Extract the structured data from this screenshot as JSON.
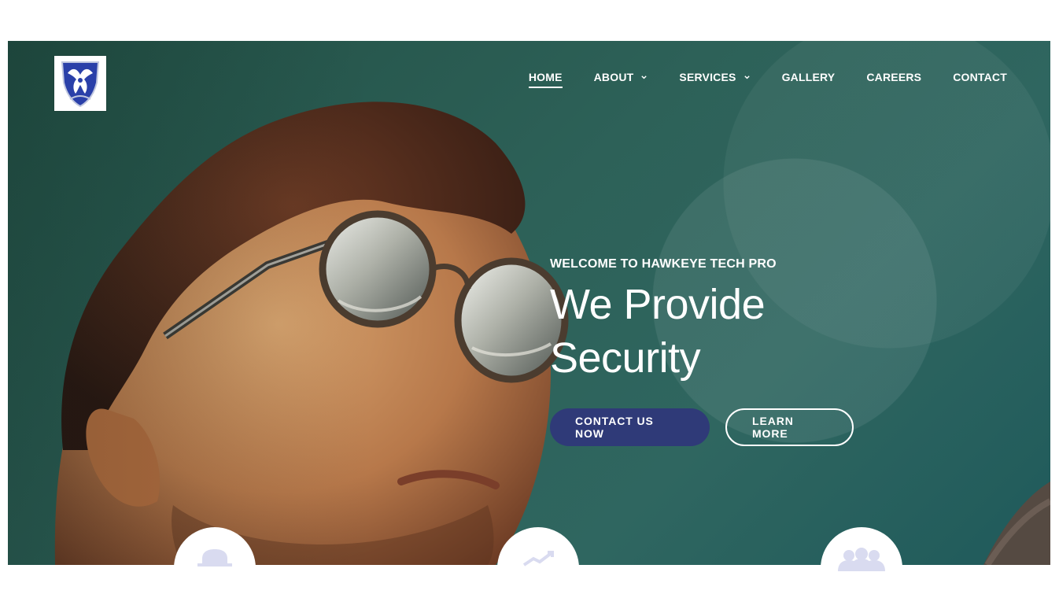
{
  "brand": {
    "logo_icon": "hawk-shield-logo"
  },
  "nav": {
    "items": [
      {
        "label": "HOME",
        "active": true,
        "dropdown": false
      },
      {
        "label": "ABOUT",
        "active": false,
        "dropdown": true
      },
      {
        "label": "SERVICES",
        "active": false,
        "dropdown": true
      },
      {
        "label": "GALLERY",
        "active": false,
        "dropdown": false
      },
      {
        "label": "CAREERS",
        "active": false,
        "dropdown": false
      },
      {
        "label": "CONTACT",
        "active": false,
        "dropdown": false
      }
    ]
  },
  "hero": {
    "eyebrow": "WELCOME TO HAWKEYE TECH PRO",
    "headline_line1": "We Provide",
    "headline_line2": "Security",
    "primary_cta": "CONTACT US NOW",
    "secondary_cta": "LEARN MORE"
  },
  "features": {
    "icons": [
      "hat-icon",
      "chart-icon",
      "team-icon"
    ]
  },
  "colors": {
    "primary": "#2f3a78",
    "hero_overlay": "#2d6158",
    "text": "#ffffff",
    "feature_icon": "#d9dbf0"
  }
}
